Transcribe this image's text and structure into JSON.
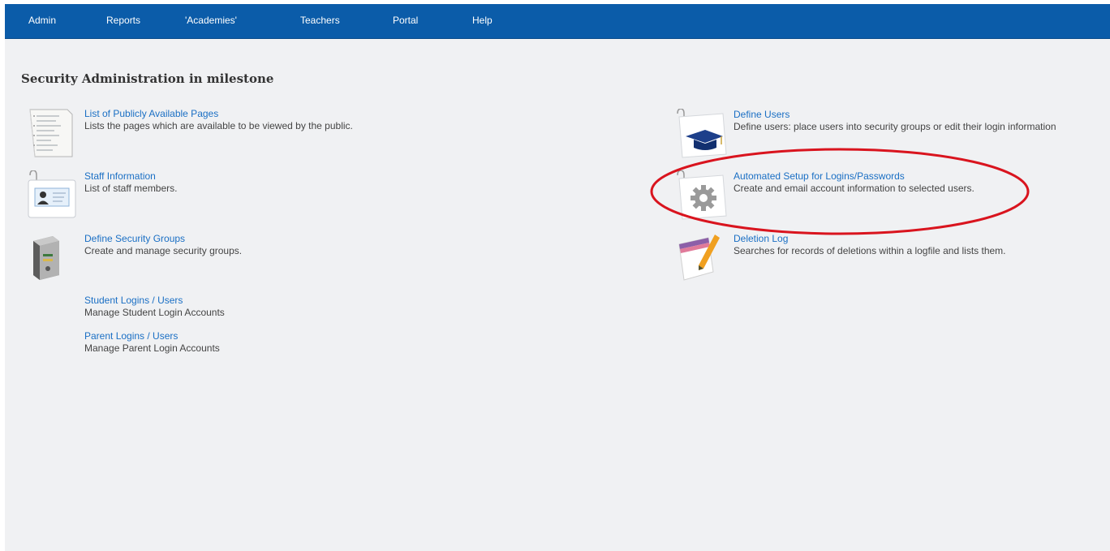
{
  "nav": {
    "items": [
      {
        "label": "Admin"
      },
      {
        "label": "Reports"
      },
      {
        "label": "'Academies'"
      },
      {
        "label": "Teachers"
      },
      {
        "label": "Portal"
      },
      {
        "label": "Help"
      }
    ]
  },
  "page": {
    "title": "Security Administration in milestone"
  },
  "left_column": [
    {
      "link": "List of Publicly Available Pages",
      "desc": "Lists the pages which are available to be viewed by the public.",
      "icon": "document-list-icon"
    },
    {
      "link": "Staff Information",
      "desc": "List of staff members.",
      "icon": "id-card-icon"
    },
    {
      "link": "Define Security Groups",
      "desc": "Create and manage security groups.",
      "icon": "safe-icon"
    },
    {
      "link": "Student Logins / Users",
      "desc": "Manage Student Login Accounts"
    },
    {
      "link": "Parent Logins / Users",
      "desc": "Manage Parent Login Accounts"
    }
  ],
  "right_column": [
    {
      "link": "Define Users",
      "desc": "Define users: place users into security groups or edit their login information",
      "icon": "graduation-cap-icon"
    },
    {
      "link": "Automated Setup for Logins/Passwords",
      "desc": "Create and email account information to selected users.",
      "icon": "gear-icon"
    },
    {
      "link": "Deletion Log",
      "desc": "Searches for records of deletions within a logfile and lists them.",
      "icon": "notepad-pencil-icon"
    }
  ],
  "colors": {
    "navbar": "#0b5ca9",
    "link": "#1a6fc4",
    "background": "#f0f1f3",
    "annotation": "#d9141e"
  }
}
